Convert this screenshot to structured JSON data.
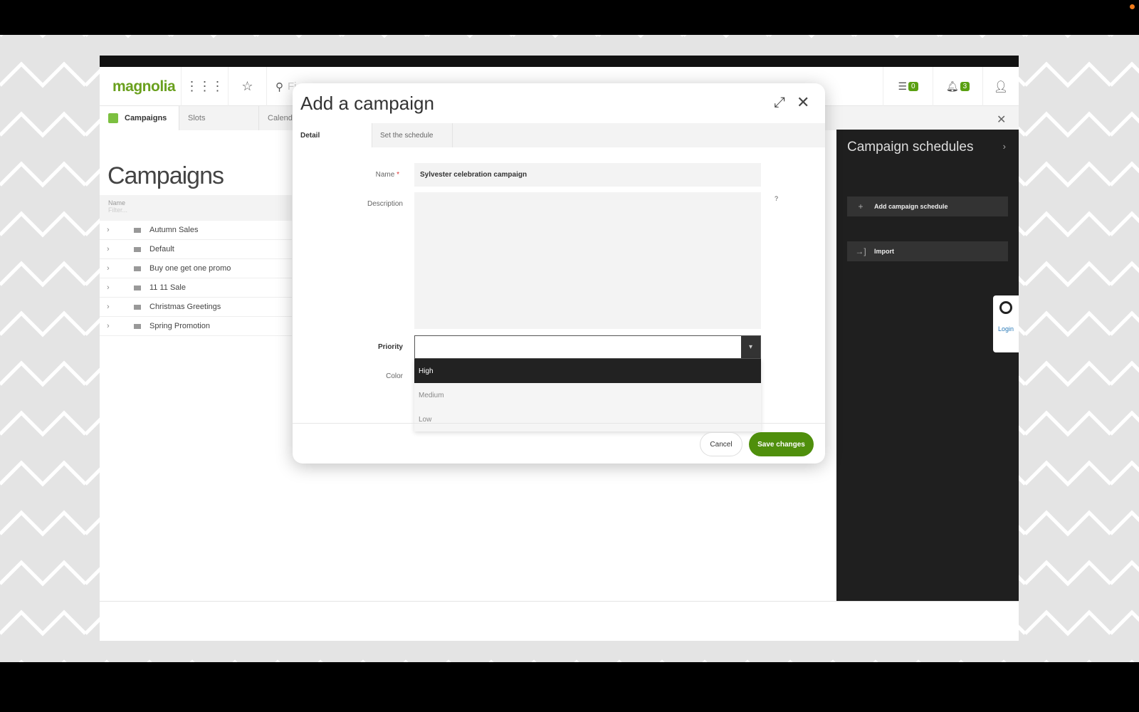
{
  "app": {
    "logo": "magnolia",
    "search_placeholder": "Fi...",
    "tasks_count": "0",
    "notifications_count": "3"
  },
  "tabs": [
    {
      "label": "Campaigns"
    },
    {
      "label": "Slots"
    },
    {
      "label": "Calendar"
    }
  ],
  "page_title": "Campaigns",
  "list": {
    "column": "Name",
    "filter_placeholder": "Filter...",
    "items": [
      "Autumn Sales",
      "Default",
      "Buy one get one promo",
      "11 11 Sale",
      "Christmas Greetings",
      "Spring Promotion"
    ]
  },
  "side_panel": {
    "title": "Campaign schedules",
    "add_label": "Add campaign schedule",
    "import_label": "Import",
    "login_label": "Login"
  },
  "modal": {
    "title": "Add a campaign",
    "tabs": [
      {
        "label": "Detail"
      },
      {
        "label": "Set the schedule"
      }
    ],
    "name_label": "Name",
    "required_mark": "*",
    "name_value": "Sylvester celebration campaign",
    "description_label": "Description",
    "description_value": "",
    "help": "?",
    "priority_label": "Priority",
    "priority_value": "",
    "priority_options": [
      "High",
      "Medium",
      "Low"
    ],
    "color_label": "Color",
    "cancel_label": "Cancel",
    "save_label": "Save changes"
  },
  "colors": {
    "brand": "#6aa01e",
    "save": "#4f8f0c"
  }
}
